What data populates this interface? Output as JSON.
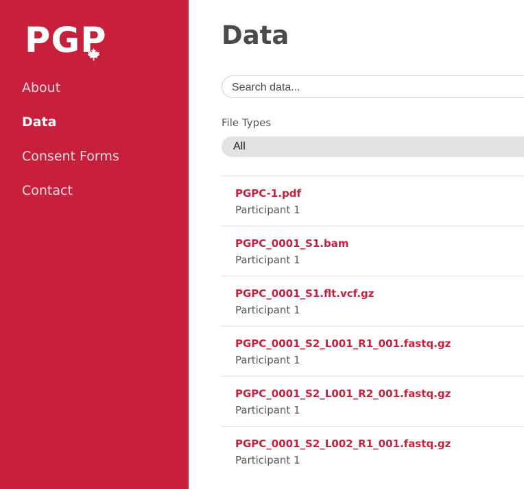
{
  "sidebar": {
    "logo_text": "PGP",
    "logo_icon": "maple-leaf-icon",
    "nav": [
      {
        "label": "About"
      },
      {
        "label": "Data",
        "active": true
      },
      {
        "label": "Consent Forms"
      },
      {
        "label": "Contact"
      }
    ],
    "background_color": "#c8203c"
  },
  "main": {
    "title": "Data",
    "search": {
      "placeholder": "Search data...",
      "value": ""
    },
    "file_types": {
      "label": "File Types",
      "selected": "All"
    },
    "files": [
      {
        "name": "PGPC-1.pdf",
        "participant": "Participant 1"
      },
      {
        "name": "PGPC_0001_S1.bam",
        "participant": "Participant 1"
      },
      {
        "name": "PGPC_0001_S1.flt.vcf.gz",
        "participant": "Participant 1"
      },
      {
        "name": "PGPC_0001_S2_L001_R1_001.fastq.gz",
        "participant": "Participant 1"
      },
      {
        "name": "PGPC_0001_S2_L001_R2_001.fastq.gz",
        "participant": "Participant 1"
      },
      {
        "name": "PGPC_0001_S2_L002_R1_001.fastq.gz",
        "participant": "Participant 1"
      }
    ]
  },
  "colors": {
    "accent": "#c8203c",
    "text_gray": "#5a5a5a"
  }
}
